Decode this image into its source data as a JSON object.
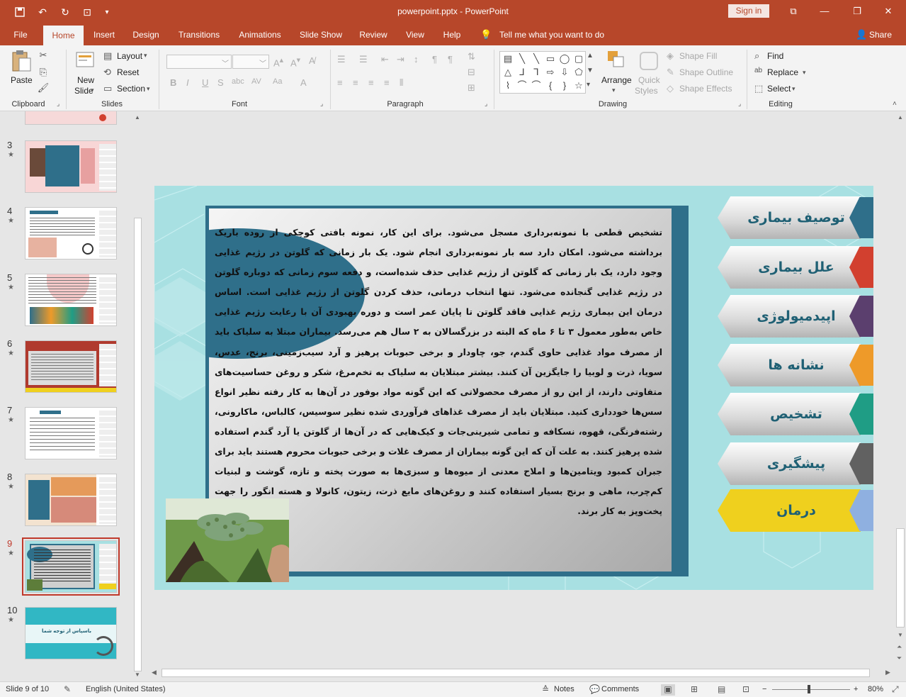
{
  "window": {
    "title": "powerpoint.pptx  -  PowerPoint",
    "sign_in": "Sign in"
  },
  "tabs": [
    {
      "label": "File"
    },
    {
      "label": "Home"
    },
    {
      "label": "Insert"
    },
    {
      "label": "Design"
    },
    {
      "label": "Transitions"
    },
    {
      "label": "Animations"
    },
    {
      "label": "Slide Show"
    },
    {
      "label": "Review"
    },
    {
      "label": "View"
    },
    {
      "label": "Help"
    }
  ],
  "tell_me": "Tell me what you want to do",
  "share": "Share",
  "ribbon": {
    "clipboard": {
      "paste": "Paste",
      "group": "Clipboard"
    },
    "slides": {
      "new_slide_1": "New",
      "new_slide_2": "Slide",
      "layout": "Layout",
      "reset": "Reset",
      "section": "Section",
      "group": "Slides"
    },
    "font": {
      "group": "Font"
    },
    "paragraph": {
      "group": "Paragraph"
    },
    "drawing": {
      "arrange": "Arrange",
      "quick_styles_1": "Quick",
      "quick_styles_2": "Styles",
      "shape_fill": "Shape Fill",
      "shape_outline": "Shape Outline",
      "shape_effects": "Shape Effects",
      "group": "Drawing"
    },
    "editing": {
      "find": "Find",
      "replace": "Replace",
      "select": "Select",
      "group": "Editing"
    }
  },
  "thumbnails": [
    {
      "num": "3",
      "star": "★"
    },
    {
      "num": "4",
      "star": "★"
    },
    {
      "num": "5",
      "star": "★"
    },
    {
      "num": "6",
      "star": "★"
    },
    {
      "num": "7",
      "star": "★"
    },
    {
      "num": "8",
      "star": "★"
    },
    {
      "num": "9",
      "star": "★"
    },
    {
      "num": "10",
      "star": "★"
    }
  ],
  "thumb10_text": "باسپاس از توجه شما",
  "slide": {
    "body": "تشخیص قطعی با نمونه‌برداری مسجل می‌شود. برای این کار، نمونه بافتی کوچکی از روده باریک برداشته می‌شود. امکان دارد سه بار نمونه‌برداری انجام شود. یک بار زمانی که گلوتن در رژیم غذایی وجود دارد، یک بار زمانی که گلوتن از رژیم غذایی حذف شده‌است، و دفعه سوم زمانی که دوباره گلوتن در رژیم غذایی گنجانده می‌شود. تنها انتخاب درمانی، حذف کردن گلوتن از رژیم غذایی است. اساس درمان این بیماری رژیم غذایی فاقد گلوتن تا پایان عمر است و دوره بهبودی آن با رعایت رژیم غذایی خاص به‌طور معمول ۳ تا ۶ ماه که البته در بزرگسالان به ۲ سال هم می‌رسد. بیماران مبتلا به سلیاک باید از مصرف مواد غذایی حاوی گندم، جو، چاودار و برخی حبوبات پرهیز و آرد سیب‌زمینی، برنج، عدس، سویا، ذرت و لوبیا را جایگزین آن کنند. بیشتر مبتلایان به سلیاک به تخم‌مرغ، شکر و روغن حساسیت‌های متفاوتی دارند، از این رو از مصرف محصولاتی که این گونه مواد بوفور در آن‌ها به کار رفته نظیر انواع سس‌ها خودداری کنید. مبتلایان باید از مصرف غذاهای فرآوردی شده نظیر سوسیس، کالباس، ماکارونی، رشته‌فرنگی، قهوه، نسکافه و تمامی شیرینی‌جات و کیک‌هایی که در آن‌ها از گلوتن یا آرد گندم استفاده شده پرهیز کنند. به علت آن که این گونه بیماران از مصرف غلات و برخی حبوبات محروم هستند باید برای جبران کمبود ویتامین‌ها و املاح معدنی از میوه‌ها و سبزی‌ها به صورت پخته و تازه، گوشت و لبنیات کم‌چرب، ماهی و برنج بسیار استفاده کنند و روغن‌های مایع ذرت، زیتون، کانولا و هسته انگور را جهت پخت‌وپز به کار برند.",
    "menu": [
      {
        "label": "توصیف بیماری",
        "color": "#2f6f8a"
      },
      {
        "label": "علل بیماری",
        "color": "#d2402f"
      },
      {
        "label": "اپیدمیولوژی",
        "color": "#5b3f6e"
      },
      {
        "label": "نشانه ها",
        "color": "#ee9a29"
      },
      {
        "label": "تشخیص",
        "color": "#1f9d85"
      },
      {
        "label": "پیشگیری",
        "color": "#616161"
      },
      {
        "label": "درمان",
        "color": "#8fb0e0"
      }
    ],
    "active_menu_color": "#efd01e"
  },
  "status": {
    "slide_of": "Slide 9 of 10",
    "language": "English (United States)",
    "notes": "Notes",
    "comments": "Comments",
    "zoom": "80%"
  },
  "colors": {
    "accent": "#b7472a",
    "selection": "#c0392b"
  }
}
